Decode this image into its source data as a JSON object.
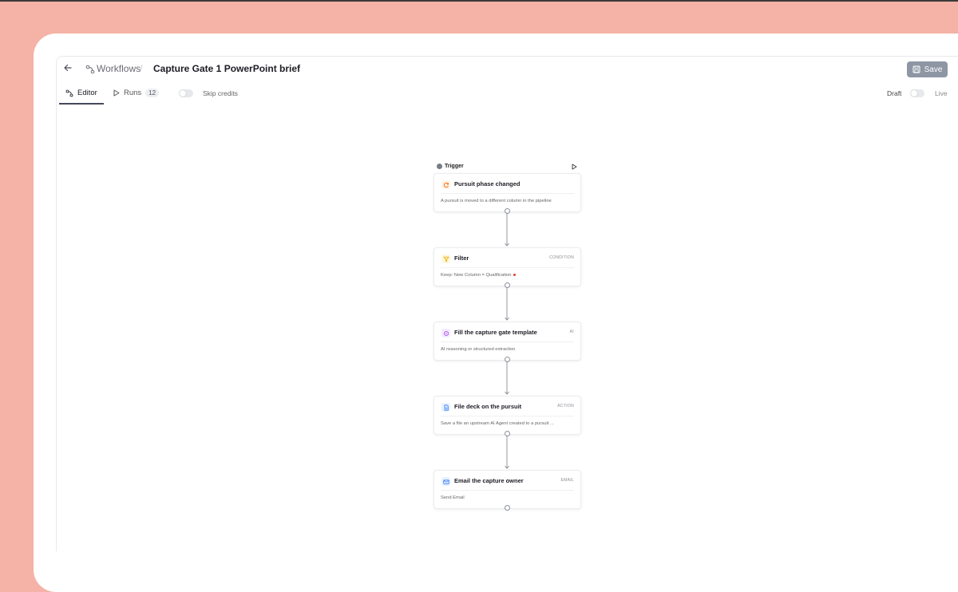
{
  "header": {
    "back_icon": "arrow-left-icon",
    "breadcrumb_root": "Workflows",
    "breadcrumb_separator": "/",
    "title": "Capture Gate 1 PowerPoint brief",
    "save_label": "Save"
  },
  "tabs": {
    "editor_label": "Editor",
    "runs_label": "Runs",
    "runs_count": "12",
    "skip_credits_label": "Skip credits"
  },
  "status": {
    "draft_label": "Draft",
    "live_label": "Live"
  },
  "workflow": {
    "trigger_label": "Trigger",
    "nodes": [
      {
        "title": "Pursuit phase changed",
        "tag": "",
        "description": "A pursuit is moved to a different column in the pipeline",
        "icon": "refresh-icon",
        "color": "#f97316"
      },
      {
        "title": "Filter",
        "tag": "CONDITION",
        "description": "Keep: New Column = Qualification",
        "icon": "filter-icon",
        "color": "#eab308"
      },
      {
        "title": "Fill the capture gate template",
        "tag": "AI",
        "description": "AI reasoning or structured extraction",
        "icon": "ai-sparkle-icon",
        "color": "#a855f7"
      },
      {
        "title": "File deck on the pursuit",
        "tag": "ACTION",
        "description": "Save a file an upstream AI Agent created to a pursuit ...",
        "icon": "document-icon",
        "color": "#3b82f6"
      },
      {
        "title": "Email the capture owner",
        "tag": "EMAIL",
        "description": "Send Email",
        "icon": "mail-icon",
        "color": "#3b82f6"
      }
    ]
  }
}
